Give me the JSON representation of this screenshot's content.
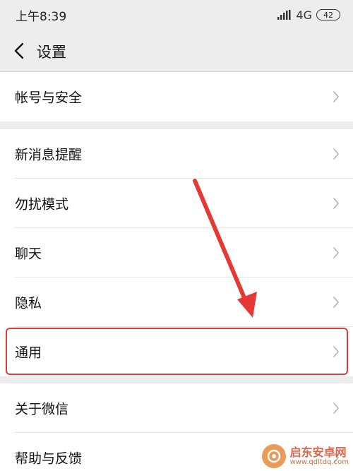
{
  "status_bar": {
    "time": "上午8:39",
    "network": "4G",
    "battery": "42"
  },
  "navbar": {
    "title": "设置"
  },
  "groups": [
    {
      "items": [
        {
          "label": "帐号与安全"
        }
      ]
    },
    {
      "items": [
        {
          "label": "新消息提醒"
        },
        {
          "label": "勿扰模式"
        },
        {
          "label": "聊天"
        },
        {
          "label": "隐私"
        },
        {
          "label": "通用"
        }
      ]
    },
    {
      "items": [
        {
          "label": "关于微信"
        },
        {
          "label": "帮助与反馈"
        }
      ]
    }
  ],
  "annotation": {
    "highlight_color": "#e53935",
    "highlighted_item": "通用"
  },
  "watermark": {
    "name": "启东安卓网",
    "url": "www.qdltdq.com"
  }
}
